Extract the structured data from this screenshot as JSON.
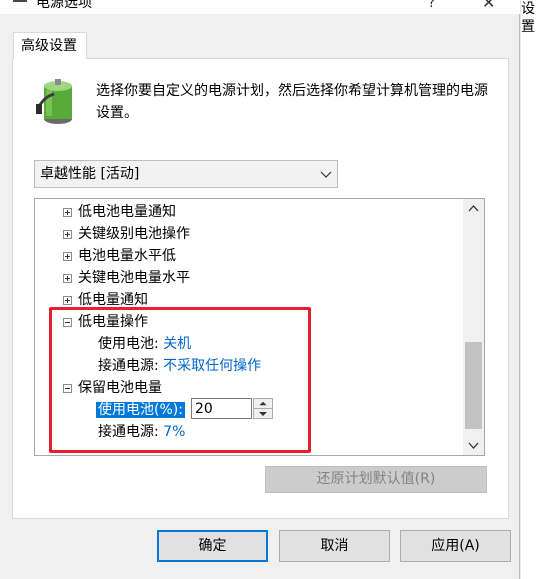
{
  "window": {
    "title": "电源选项",
    "help_glyph": "?",
    "close_glyph": "✕"
  },
  "background_text": "设置",
  "tab": {
    "label": "高级设置"
  },
  "description": "选择你要自定义的电源计划，然后选择你希望计算机管理的电源设置。",
  "plan_select": {
    "value": "卓越性能 [活动]"
  },
  "tree": {
    "items": [
      {
        "label": "低电池电量通知",
        "expanded": false
      },
      {
        "label": "关键级别电池操作",
        "expanded": false
      },
      {
        "label": "电池电量水平低",
        "expanded": false
      },
      {
        "label": "关键电池电量水平",
        "expanded": false
      },
      {
        "label": "低电量通知",
        "expanded": false
      }
    ],
    "low_power_action": {
      "label": "低电量操作",
      "expanded": true,
      "on_battery_label": "使用电池:",
      "on_battery_value": "关机",
      "plugged_in_label": "接通电源:",
      "plugged_in_value": "不采取任何操作"
    },
    "reserve_battery": {
      "label": "保留电池电量",
      "expanded": true,
      "on_battery_label": "使用电池(%):",
      "on_battery_value": "20",
      "plugged_in_label": "接通电源:",
      "plugged_in_value": "7%"
    }
  },
  "restore_button": "还原计划默认值(R)",
  "buttons": {
    "ok": "确定",
    "cancel": "取消",
    "apply": "应用(A)"
  },
  "colors": {
    "accent": "#0078d7",
    "highlight_border": "#e81f2e",
    "link": "#0066cc"
  }
}
